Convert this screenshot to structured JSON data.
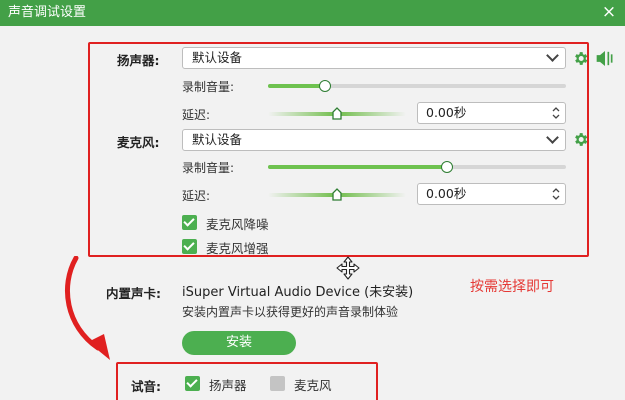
{
  "window": {
    "title": "声音调试设置",
    "close_glyph": "×"
  },
  "speaker": {
    "label": "扬声器:",
    "device": "默认设备",
    "volume_label": "录制音量:",
    "volume": 0.19,
    "delay_label": "延迟:",
    "delay": 0.5,
    "delay_value": "0.00秒"
  },
  "mic": {
    "label": "麦克风:",
    "device": "默认设备",
    "volume_label": "录制音量:",
    "volume": 0.6,
    "delay_label": "延迟:",
    "delay": 0.5,
    "delay_value": "0.00秒",
    "denoise_label": "麦克风降噪",
    "denoise_checked": true,
    "enhance_label": "麦克风增强",
    "enhance_checked": true
  },
  "soundcard": {
    "label": "内置声卡:",
    "device": "iSuper Virtual Audio Device (未安装)",
    "hint": "安装内置声卡以获得更好的声音录制体验",
    "install_label": "安装"
  },
  "test": {
    "label": "试音:",
    "speaker_label": "扬声器",
    "speaker_checked": true,
    "mic_label": "麦克风",
    "mic_checked": false
  },
  "annotation": {
    "text": "按需选择即可"
  },
  "icons": {
    "settings": "gear-icon",
    "speaker_test": "speaker-volume-icon",
    "move": "move-cursor-icon",
    "arrow": "curved-arrow-icon"
  },
  "colors": {
    "accent": "#43a047",
    "annotation": "#e02020"
  }
}
